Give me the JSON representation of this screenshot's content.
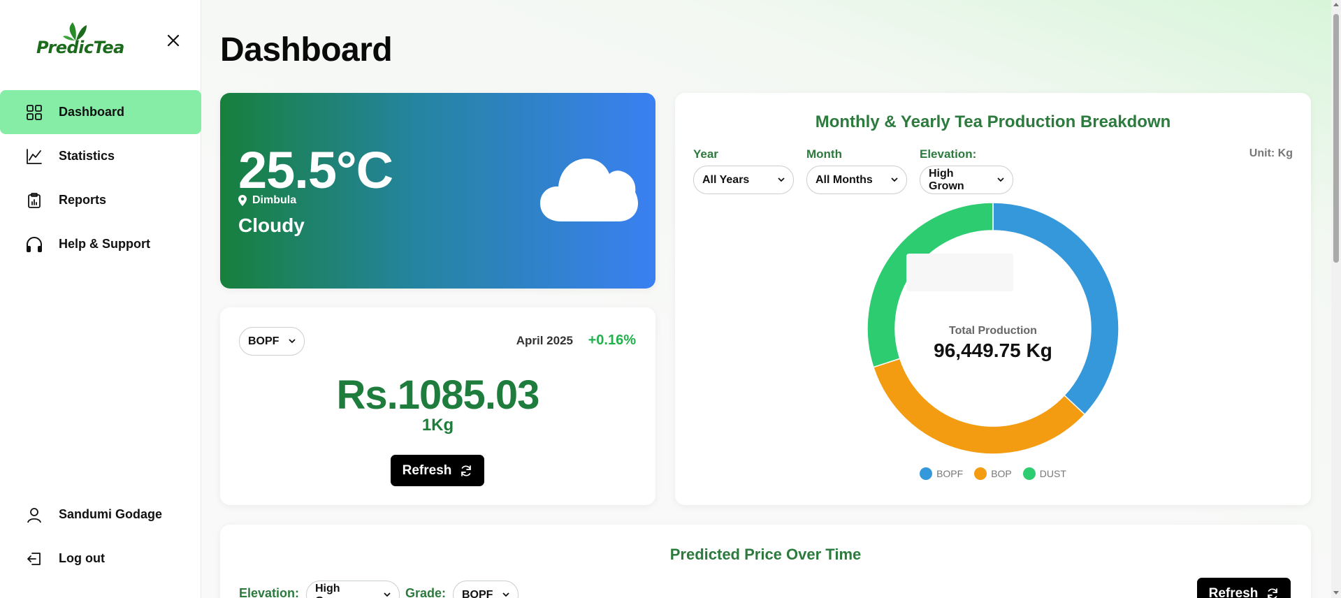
{
  "brand": {
    "name": "PredicTea",
    "accent": "#86eda7",
    "green": "#1e7d3c"
  },
  "sidebar": {
    "items": [
      {
        "label": "Dashboard",
        "icon": "grid-icon",
        "active": true
      },
      {
        "label": "Statistics",
        "icon": "line-chart-icon"
      },
      {
        "label": "Reports",
        "icon": "clipboard-icon"
      },
      {
        "label": "Help & Support",
        "icon": "headphones-icon"
      }
    ],
    "user": {
      "label": "Sandumi Godage",
      "icon": "user-icon"
    },
    "logout": {
      "label": "Log out",
      "icon": "logout-icon"
    }
  },
  "page": {
    "title": "Dashboard"
  },
  "weather": {
    "temperature": "25.5°C",
    "location": "Dimbula",
    "condition": "Cloudy",
    "icon": "cloud-icon"
  },
  "price_card": {
    "grade_select": "BOPF",
    "date": "April 2025",
    "change": "+0.16%",
    "price": "Rs.1085.03",
    "unit": "1Kg",
    "refresh_label": "Refresh"
  },
  "production": {
    "title": "Monthly & Yearly Tea Production Breakdown",
    "filters": {
      "year_label": "Year",
      "year_value": "All Years",
      "month_label": "Month",
      "month_value": "All Months",
      "elevation_label": "Elevation:",
      "elevation_value": "High Grown"
    },
    "unit_label": "Unit: Kg",
    "center_label": "Total Production",
    "center_value": "96,449.75 Kg"
  },
  "chart_data": {
    "type": "pie",
    "categories": [
      "BOPF",
      "BOP",
      "DUST"
    ],
    "values": [
      37,
      33,
      30
    ],
    "colors": [
      "#3498db",
      "#f39c12",
      "#2ecc71"
    ],
    "legend": "bottom",
    "donut": true
  },
  "prediction": {
    "title": "Predicted Price Over Time",
    "elevation_label": "Elevation:",
    "elevation_value": "High Grown",
    "grade_label": "Grade:",
    "grade_value": "BOPF",
    "refresh_label": "Refresh"
  }
}
